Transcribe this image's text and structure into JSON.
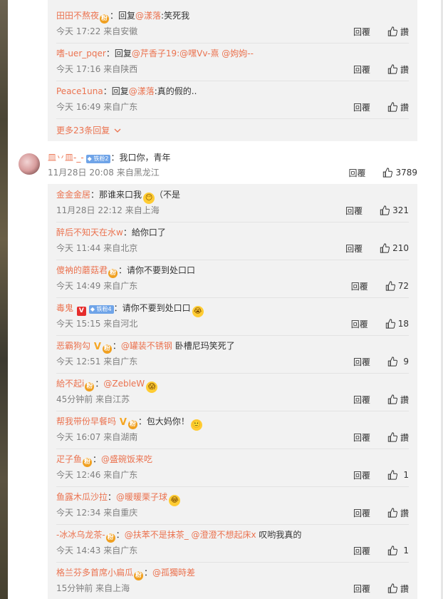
{
  "ui": {
    "reply_label": "回覆",
    "accent_color": "#eb7350",
    "panel_color": "#f2f2f2"
  },
  "earlier_replies": [
    {
      "user": "田田不熬夜",
      "badge": "fan",
      "prefix": "：回复",
      "mention": "@漾落",
      "text": ":笑死我",
      "time": "今天 17:22 来自安徽",
      "likes": "讚"
    },
    {
      "user": "嗜-uer_pqer",
      "prefix": "：回复",
      "mention": "@芹香子19:@嘿Vv-熹 @姁姁--",
      "text": "",
      "time": "今天 17:16 来自陕西",
      "likes": "讚"
    },
    {
      "user": "Peace1una",
      "prefix": "：回复",
      "mention": "@漾落",
      "text": ":真的假的..",
      "time": "今天 16:49 来自广东",
      "likes": "讚"
    }
  ],
  "more_replies": "更多23条回复",
  "top_comment": {
    "user": "皿丷皿-_-",
    "fan_label": "铁粉2",
    "text": "：我口你，青年",
    "time": "11月28日 20:08 来自黑龙江",
    "likes": "3789"
  },
  "replies": [
    {
      "user": "金金金居",
      "prefix": "：",
      "mention": "",
      "text": "那谁来口我",
      "emoji": "😶",
      "tail": "（不是",
      "time": "11月28日 22:12 来自上海",
      "likes": "321"
    },
    {
      "user": "醉后不知天在水w",
      "prefix": "：",
      "mention": "",
      "text": "給你口了",
      "time": "今天 11:44 来自北京",
      "likes": "210"
    },
    {
      "user": "傻衲的蘑菇君",
      "badge": "fan",
      "prefix": "：",
      "mention": "",
      "text": "请你不要到处口口",
      "time": "今天 14:49 来自广东",
      "likes": "72"
    },
    {
      "user": "毒鬼",
      "vred": "V",
      "fan_label": "铁粉4",
      "prefix": "：",
      "mention": "",
      "text": "请你不要到处口口",
      "emoji": "😭",
      "time": "今天 15:15 来自河北",
      "likes": "18"
    },
    {
      "user": "恶霸狗勾",
      "vgold": "V",
      "badge": "fan",
      "prefix": "：",
      "mention": "@罐装不锈钢",
      "text": " 卧槽尼玛笑死了",
      "time": "今天 12:51 来自广东",
      "likes": "9"
    },
    {
      "user": "給不起i",
      "badge": "fan",
      "prefix": "：",
      "mention": "@ZebleW",
      "text": "",
      "emoji": "😱",
      "time": "45分钟前 来自江苏",
      "likes": "讚"
    },
    {
      "user": "帮我带份早餐吗",
      "vgold": "V",
      "badge": "fan",
      "prefix": "：",
      "mention": "",
      "text": "包大妈你！",
      "emoji": "🙂",
      "time": "今天 16:07 来自湖南",
      "likes": "讚"
    },
    {
      "user": "疋子鱼",
      "badge": "fan",
      "prefix": "：",
      "mention": "@盛碗饭来吃",
      "text": "",
      "time": "今天 12:46 来自广东",
      "likes": "1"
    },
    {
      "user": "鱼露木瓜沙拉",
      "prefix": "：",
      "mention": "@暖暖栗子球",
      "text": "",
      "emoji": "😂",
      "time": "今天 12:34 来自重庆",
      "likes": "讚"
    },
    {
      "user": "-冰冰乌龙茶-",
      "badge": "fan",
      "prefix": "：",
      "mention": "@扶苯不是抹茶_ @澄澄不想起床x",
      "text": " 叹哟我真的",
      "time": "今天 14:43 来自广东",
      "likes": "1"
    },
    {
      "user": "格兰芬多首席小扁瓜",
      "badge": "fan",
      "prefix": "：",
      "mention": "@孤獨時差",
      "text": "",
      "time": "15分钟前 来自上海",
      "likes": "讚"
    }
  ]
}
